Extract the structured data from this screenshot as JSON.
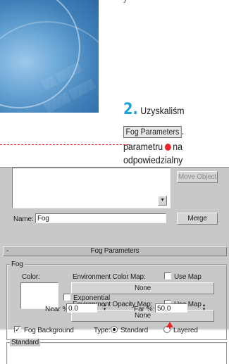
{
  "article": {
    "step_number": "2.",
    "line1": "Uzyskaliśm",
    "ui_ref": "Fog Parameters",
    "line2_suffix": ". ",
    "line3_prefix": "parametru",
    "line3_suffix": "na",
    "line4": "odpowiedzialny"
  },
  "panel": {
    "merge_object_button": "Move Object",
    "name_label": "Name:",
    "name_value": "Fog",
    "merge_button": "Merge",
    "rollout_toggle": "-",
    "rollout_title": "Fog Parameters",
    "fog_group": {
      "title": "Fog",
      "color_label": "Color:",
      "env_color_map_label": "Environment Color Map:",
      "use_map_1": "Use Map",
      "none_button_1": "None",
      "env_opacity_map_label": "Environment Opacity Map:",
      "use_map_2": "Use Map",
      "none_button_2": "None",
      "fog_background_label": "Fog Background",
      "fog_background_checked": true,
      "type_label": "Type:",
      "type_standard": "Standard",
      "type_layered": "Layered",
      "type_selected": "Standard"
    },
    "standard_group": {
      "title": "Standard",
      "exponential_label": "Exponential",
      "near_label": "Near %:",
      "near_value": "0.0",
      "far_label": "Far %:",
      "far_value": "50.0"
    }
  },
  "colors": {
    "accent_blue": "#1fa2d8",
    "marker_red": "#e3262e",
    "panel_gray": "#c8c8c8"
  }
}
